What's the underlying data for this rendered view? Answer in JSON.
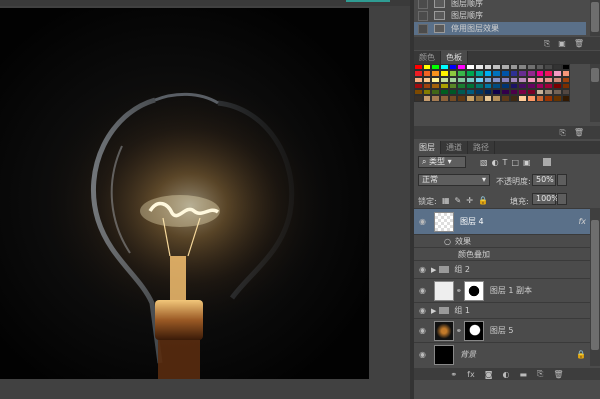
{
  "history": {
    "items": [
      {
        "label": "图层顺序",
        "selected": false
      },
      {
        "label": "图层顺序",
        "selected": false
      },
      {
        "label": "停用图层效果",
        "selected": true
      }
    ]
  },
  "color_panel": {
    "tabs": [
      "颜色",
      "色板"
    ],
    "active_tab": "色板",
    "swatch_colors": [
      "#ff0000",
      "#ffff00",
      "#00ff00",
      "#00ffff",
      "#0000ff",
      "#ff00ff",
      "#ffffff",
      "#ebebeb",
      "#d6d6d6",
      "#c2c2c2",
      "#adadad",
      "#999999",
      "#858585",
      "#707070",
      "#5c5c5c",
      "#474747",
      "#333333",
      "#000000",
      "#ee1d24",
      "#f26522",
      "#f7941d",
      "#fff200",
      "#8dc63f",
      "#39b54a",
      "#00a651",
      "#00a99d",
      "#00aeef",
      "#0072bc",
      "#0054a6",
      "#2e3192",
      "#662d91",
      "#92278f",
      "#ec008c",
      "#ed145b",
      "#f49ac2",
      "#f7977a",
      "#f9ad81",
      "#fdc68a",
      "#fff799",
      "#c4df9b",
      "#a3d39c",
      "#82ca9d",
      "#7bcdc8",
      "#6ecff6",
      "#7ea7d8",
      "#8493ca",
      "#8882be",
      "#a187be",
      "#bc8dbf",
      "#f49ac1",
      "#f5989d",
      "#e8928c",
      "#d28979",
      "#a0410d",
      "#9e0b0f",
      "#a0410d",
      "#a36209",
      "#aba000",
      "#598527",
      "#1a7b30",
      "#007236",
      "#00746b",
      "#0076a3",
      "#004b80",
      "#003471",
      "#1b1464",
      "#440e62",
      "#630460",
      "#9e005d",
      "#9e0039",
      "#790000",
      "#7b2e00",
      "#7d4900",
      "#827b00",
      "#406618",
      "#005e20",
      "#005826",
      "#005952",
      "#005b7f",
      "#003663",
      "#002157",
      "#0d004c",
      "#32004b",
      "#4b0049",
      "#7b0046",
      "#7a0026",
      "#c7b299",
      "#998675",
      "#736357",
      "#534741",
      "#37302a",
      "#c69c6d",
      "#a67c52",
      "#8c6239",
      "#754c24",
      "#603913",
      "#c8a165",
      "#8c6b3a",
      "#e6c797",
      "#b38f5a",
      "#5d3b1a",
      "#3f2a12",
      "#ffcc99",
      "#ff9966",
      "#cc6633",
      "#993300",
      "#663300",
      "#331900"
    ]
  },
  "layers_panel": {
    "tabs": [
      "图层",
      "通道",
      "路径"
    ],
    "active_tab": "图层",
    "filter_kind": "类型",
    "blend_mode": "正常",
    "opacity_label": "不透明度:",
    "opacity_value": "50%",
    "lock_label": "锁定:",
    "fill_label": "填充:",
    "fill_value": "100%",
    "layers": [
      {
        "name": "图层 4",
        "type": "layer",
        "selected": true,
        "fx": "fx"
      },
      {
        "name": "效果",
        "type": "effect-header"
      },
      {
        "name": "颜色叠加",
        "type": "effect"
      },
      {
        "name": "组 2",
        "type": "group"
      },
      {
        "name": "图层 1 副本",
        "type": "masked"
      },
      {
        "name": "组 1",
        "type": "group"
      },
      {
        "name": "图层 5",
        "type": "masked"
      },
      {
        "name": "背景",
        "type": "background"
      }
    ]
  }
}
